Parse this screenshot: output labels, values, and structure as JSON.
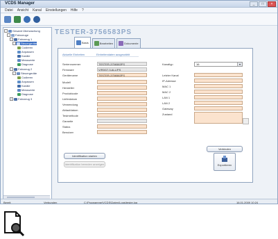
{
  "window": {
    "title": "VCDS Manager",
    "controls": {
      "minimize": "_",
      "maximize": "□",
      "close": "×"
    }
  },
  "menu": [
    "Datei",
    "Ansicht",
    "Kanal",
    "Einstellungen",
    "Hilfe",
    "?"
  ],
  "toolbar": {
    "icons": [
      "new-icon",
      "open-icon",
      "refresh-icon",
      "settings-icon"
    ]
  },
  "tree": {
    "root": "Gesamt Überwachung",
    "items": [
      "Fahrzeuge",
      "Fahrzeug 1",
      "Steuergeräte",
      "Codieren",
      "Anpassen",
      "Kanäle",
      "Messwerte",
      "Diagnose",
      "Fahrzeug 2",
      "Steuergeräte",
      "Codieren",
      "Anpassen",
      "Kanäle",
      "Messwerte",
      "Diagnose",
      "Fahrzeug 3"
    ]
  },
  "brand": "TESTER-3756583PS",
  "tabs": [
    {
      "label": "Basis"
    },
    {
      "label": "Bearbeiten"
    },
    {
      "label": "Dokumente"
    }
  ],
  "panel": {
    "section_left": "Aktuelle Einheiten",
    "section_right": "Einheitendaten ausgewählt",
    "left_labels": [
      "Seriennummer",
      "Firmware",
      "Gerätename",
      "Modell",
      "Hersteller",
      "Produktcode",
      "Lieferdatum",
      "Verwendung",
      "Ablaufdatum",
      "Testmethode",
      "Garantie",
      "Status",
      "Benutzer"
    ],
    "left_values": [
      "TESTER-3756583PS",
      "V/R0G7.3.ALL/PS",
      "TESTER-3756583PS",
      "",
      "",
      "",
      "",
      "",
      "",
      "",
      "",
      "",
      ""
    ],
    "right_top_label": "Kanaltyp",
    "right_top_value": "16",
    "right_labels": [
      "Letzter Kanal",
      "IP-Adresse",
      "MAC 1",
      "MAC 2",
      "LAN 1",
      "LAN 2",
      "Gateway",
      "Zustand"
    ],
    "right_values": [
      "",
      "",
      "",
      "",
      "",
      "",
      "",
      ""
    ]
  },
  "buttons": {
    "identify": "Identifikation starten",
    "identify_disabled": "Identifikation beenden anzeigen",
    "connect": "Verbinden",
    "export": "Exportieren"
  },
  "statusbar": {
    "left": "Bereit",
    "mid1": "Verbunden",
    "mid2": "C:\\Programme\\VCDS\\Daten\\Logs\\tester.log",
    "right": "16.01.2009 10:24"
  }
}
